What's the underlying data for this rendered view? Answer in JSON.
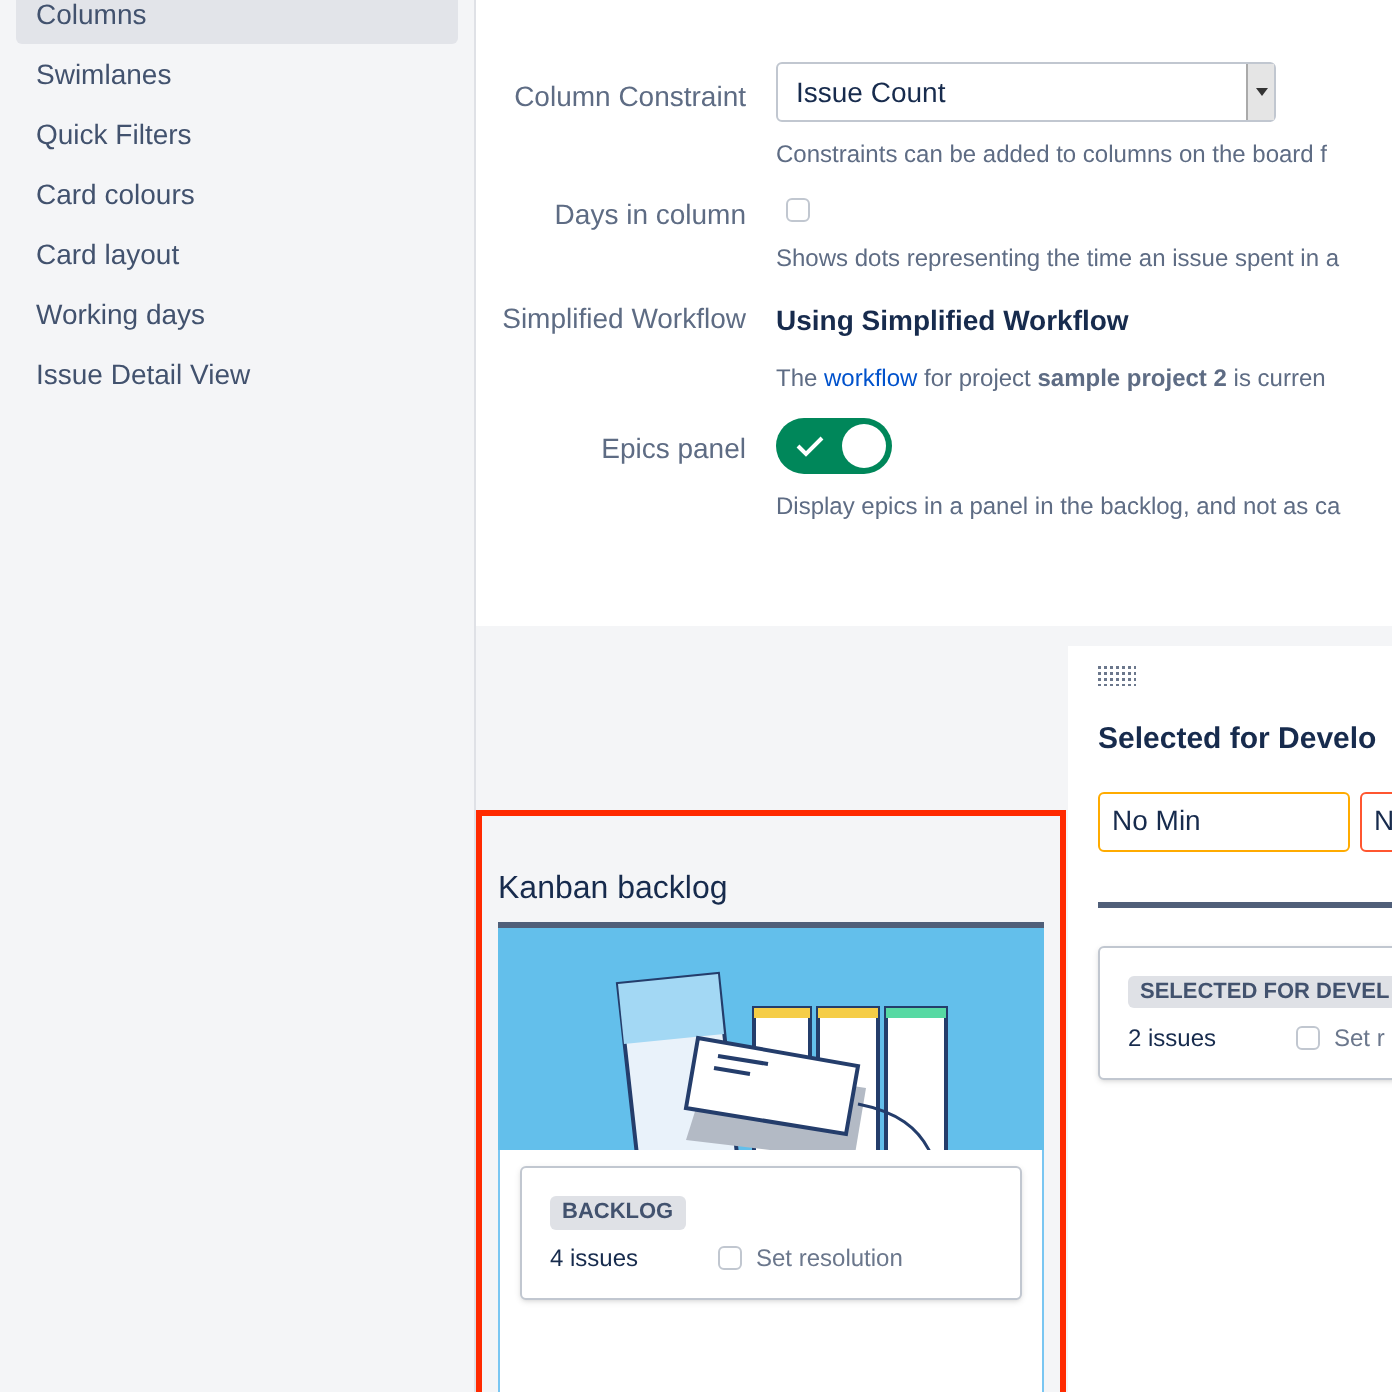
{
  "sidebar": {
    "items": [
      {
        "label": "Columns",
        "selected": true
      },
      {
        "label": "Swimlanes",
        "selected": false
      },
      {
        "label": "Quick Filters",
        "selected": false
      },
      {
        "label": "Card colours",
        "selected": false
      },
      {
        "label": "Card layout",
        "selected": false
      },
      {
        "label": "Working days",
        "selected": false
      },
      {
        "label": "Issue Detail View",
        "selected": false
      }
    ]
  },
  "settings": [
    {
      "kind": "select",
      "label": "Column Constraint",
      "value": "Issue Count",
      "help": [
        {
          "kind": "plain",
          "text": "Constraints can be added to columns on the board f"
        }
      ]
    },
    {
      "kind": "checkbox",
      "label": "Days in column",
      "checked": false,
      "help": [
        {
          "kind": "plain",
          "text": "Shows dots representing the time an issue spent in a"
        }
      ]
    },
    {
      "kind": "text",
      "label": "Simplified Workflow",
      "value": "Using Simplified Workflow",
      "help": [
        {
          "kind": "plain",
          "text": "The "
        },
        {
          "kind": "link",
          "text": "workflow"
        },
        {
          "kind": "plain",
          "text": " for project "
        },
        {
          "kind": "bold",
          "text": "sample project 2"
        },
        {
          "kind": "plain",
          "text": " is curren"
        }
      ]
    },
    {
      "kind": "toggle",
      "label": "Epics panel",
      "on": true,
      "help": [
        {
          "kind": "plain",
          "text": "Display epics in a panel in the backlog, and not as ca"
        }
      ]
    }
  ],
  "board": {
    "columns": [
      {
        "kind": "backlog",
        "title": "Kanban backlog",
        "highlighted": true,
        "status": "BACKLOG",
        "count": "4 issues",
        "resolution": {
          "label": "Set resolution",
          "checked": false
        }
      },
      {
        "kind": "status",
        "title": "Selected for Develo",
        "min": "No Min",
        "max": "N",
        "status": "SELECTED FOR DEVEL",
        "count": "2 issues",
        "resolution": {
          "label": "Set r",
          "checked": false
        }
      }
    ]
  }
}
